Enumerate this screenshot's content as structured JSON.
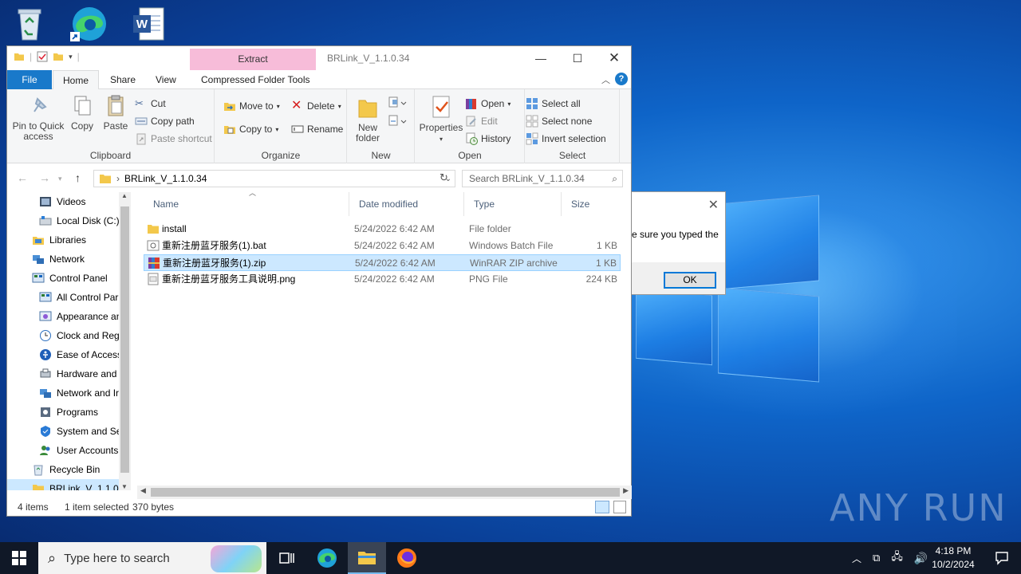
{
  "desktop": {
    "icons": [
      "recycle-bin",
      "microsoft-edge",
      "word-document"
    ],
    "watermark": "ANY RUN"
  },
  "window": {
    "title": "BRLink_V_1.1.0.34",
    "contextual_tab": "Extract",
    "tabs": [
      "File",
      "Home",
      "Share",
      "View",
      "Compressed Folder Tools"
    ],
    "active_tab": "Home",
    "ribbon": {
      "clipboard": {
        "label": "Clipboard",
        "pin": "Pin to Quick access",
        "copy": "Copy",
        "paste": "Paste",
        "cut": "Cut",
        "copy_path": "Copy path",
        "paste_shortcut": "Paste shortcut"
      },
      "organize": {
        "label": "Organize",
        "move_to": "Move to",
        "copy_to": "Copy to",
        "delete": "Delete",
        "rename": "Rename"
      },
      "new": {
        "label": "New",
        "new_folder": "New folder"
      },
      "open": {
        "label": "Open",
        "properties": "Properties",
        "open": "Open",
        "edit": "Edit",
        "history": "History"
      },
      "select": {
        "label": "Select",
        "select_all": "Select all",
        "select_none": "Select none",
        "invert": "Invert selection"
      }
    },
    "address": {
      "path": "BRLink_V_1.1.0.34",
      "search_placeholder": "Search BRLink_V_1.1.0.34"
    },
    "nav_items": [
      {
        "label": "Videos",
        "icon": "videos-icon"
      },
      {
        "label": "Local Disk (C:)",
        "icon": "drive-icon"
      },
      {
        "label": "Libraries",
        "icon": "libraries-icon"
      },
      {
        "label": "Network",
        "icon": "network-icon"
      },
      {
        "label": "Control Panel",
        "icon": "control-panel-icon"
      },
      {
        "label": "All Control Par",
        "icon": "control-panel-icon"
      },
      {
        "label": "Appearance an",
        "icon": "appearance-icon"
      },
      {
        "label": "Clock and Regi",
        "icon": "clock-icon"
      },
      {
        "label": "Ease of Access",
        "icon": "ease-of-access-icon"
      },
      {
        "label": "Hardware and",
        "icon": "hardware-icon"
      },
      {
        "label": "Network and Ir",
        "icon": "network-icon"
      },
      {
        "label": "Programs",
        "icon": "programs-icon"
      },
      {
        "label": "System and Sec",
        "icon": "security-icon"
      },
      {
        "label": "User Accounts",
        "icon": "user-accounts-icon"
      },
      {
        "label": "Recycle Bin",
        "icon": "recycle-bin-icon"
      },
      {
        "label": "BRLink_V_1.1.0.3",
        "icon": "folder-icon"
      }
    ],
    "columns": {
      "name": "Name",
      "date": "Date modified",
      "type": "Type",
      "size": "Size"
    },
    "files": [
      {
        "name": "install",
        "date": "5/24/2022 6:42 AM",
        "type": "File folder",
        "size": "",
        "icon": "folder-icon"
      },
      {
        "name": "重新注册蓝牙服务(1).bat",
        "date": "5/24/2022 6:42 AM",
        "type": "Windows Batch File",
        "size": "1 KB",
        "icon": "batch-file-icon"
      },
      {
        "name": "重新注册蓝牙服务(1).zip",
        "date": "5/24/2022 6:42 AM",
        "type": "WinRAR ZIP archive",
        "size": "1 KB",
        "icon": "winrar-icon"
      },
      {
        "name": "重新注册蓝牙服务工具说明.png",
        "date": "5/24/2022 6:42 AM",
        "type": "PNG File",
        "size": "224 KB",
        "icon": "image-file-icon"
      }
    ],
    "status": {
      "items": "4 items",
      "selected": "1 item selected",
      "bytes": "370 bytes"
    }
  },
  "dialog": {
    "message": "e sure you typed the",
    "ok": "OK"
  },
  "taskbar": {
    "search_placeholder": "Type here to search",
    "time": "4:18 PM",
    "date": "10/2/2024"
  }
}
